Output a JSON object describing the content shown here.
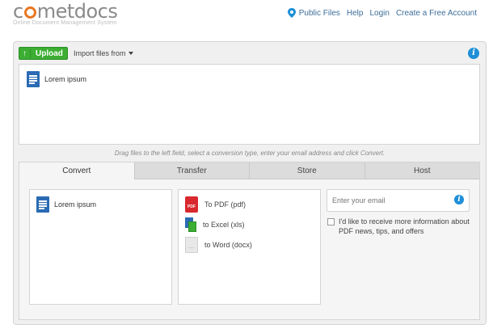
{
  "header": {
    "logo_prefix": "c",
    "logo_suffix": "metdocs",
    "tagline": "Online Document Management System",
    "nav": [
      "Public Files",
      "Help",
      "Login",
      "Create a Free Account"
    ]
  },
  "toolbar": {
    "upload_label": "Upload",
    "import_label": "Import files from"
  },
  "upload_area": {
    "files": [
      {
        "name": "Lorem ipsum",
        "icon": "document-icon"
      }
    ]
  },
  "hint": "Drag files to the left field, select a conversion type, enter your email address and click Convert.",
  "tabs": [
    {
      "label": "Convert",
      "active": true
    },
    {
      "label": "Transfer",
      "active": false
    },
    {
      "label": "Store",
      "active": false
    },
    {
      "label": "Host",
      "active": false
    }
  ],
  "convert": {
    "selected_files": [
      {
        "name": "Lorem ipsum"
      }
    ],
    "types": [
      {
        "label": "To PDF (pdf)",
        "icon": "pdf-icon",
        "icon_text": "PDF"
      },
      {
        "label": "to Excel (xls)",
        "icon": "excel-icon"
      },
      {
        "label": "to Word (docx)",
        "icon": "word-icon",
        "icon_text": "..."
      }
    ],
    "email_placeholder": "Enter your email",
    "optin_label": "I'd like to receive more information about PDF news, tips, and offers"
  },
  "colors": {
    "brand_orange": "#e87722",
    "upload_green": "#3cae33",
    "info_blue": "#1d8fd8",
    "link_blue": "#3d6e99",
    "pdf_red": "#d9272e",
    "doc_blue": "#2a6bb4"
  }
}
